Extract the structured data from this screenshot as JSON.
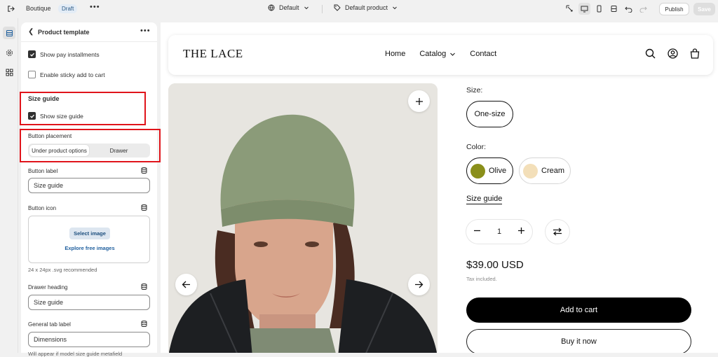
{
  "topbar": {
    "store_name": "Boutique",
    "status_badge": "Draft",
    "theme_select": "Default",
    "template_select": "Default product",
    "publish_label": "Publish",
    "save_label": "Save"
  },
  "panel": {
    "title": "Product template",
    "show_pay_installments": "Show pay installments",
    "enable_sticky": "Enable sticky add to cart",
    "size_guide_heading": "Size guide",
    "show_size_guide": "Show size guide",
    "button_placement_label": "Button placement",
    "placement_options": [
      "Under product options",
      "Drawer"
    ],
    "button_label_label": "Button label",
    "button_label_value": "Size guide",
    "button_icon_label": "Button icon",
    "select_image": "Select image",
    "explore_images": "Explore free images",
    "icon_hint": "24 x 24px .svg recommended",
    "drawer_heading_label": "Drawer heading",
    "drawer_heading_value": "Size guide",
    "general_tab_label": "General tab label",
    "general_tab_value": "Dimensions",
    "trailing_hint": "Will appear if model size guide metafield"
  },
  "store": {
    "logo": "THE LACE",
    "nav": [
      "Home",
      "Catalog",
      "Contact"
    ],
    "size_label": "Size:",
    "size_option": "One-size",
    "color_label": "Color:",
    "colors": [
      {
        "name": "Olive",
        "hex": "#8a8f1a"
      },
      {
        "name": "Cream",
        "hex": "#f3dfb9"
      }
    ],
    "size_guide_link": "Size guide",
    "quantity": "1",
    "price": "$39.00 USD",
    "tax_note": "Tax included.",
    "add_to_cart": "Add to cart",
    "buy_now": "Buy it now"
  },
  "colors": {
    "highlight": "#e0141b",
    "accent_dark": "#303030"
  }
}
